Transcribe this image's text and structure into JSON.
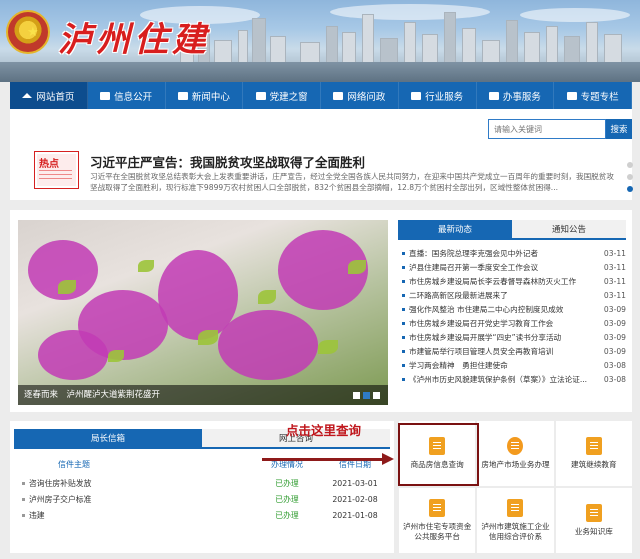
{
  "header": {
    "site_title": "泸州住建"
  },
  "nav": {
    "items": [
      {
        "label": "网站首页",
        "icon": "home-icon",
        "active": true
      },
      {
        "label": "信息公开",
        "icon": "info-icon"
      },
      {
        "label": "新闻中心",
        "icon": "news-icon"
      },
      {
        "label": "党建之窗",
        "icon": "party-icon"
      },
      {
        "label": "网络问政",
        "icon": "consult-icon"
      },
      {
        "label": "行业服务",
        "icon": "service-icon"
      },
      {
        "label": "办事服务",
        "icon": "affairs-icon"
      },
      {
        "label": "专题专栏",
        "icon": "topic-icon"
      }
    ]
  },
  "search": {
    "placeholder": "请输入关键词",
    "button": "搜索"
  },
  "feature": {
    "badge": "热点",
    "headline": "习近平庄严宣告：我国脱贫攻坚战取得了全面胜利",
    "summary": "习近平在全国脱贫攻坚总结表彰大会上发表重要讲话，庄严宣告，经过全党全国各族人民共同努力，在迎来中国共产党成立一百周年的重要时刻，我国脱贫攻坚战取得了全面胜利，现行标准下9899万农村贫困人口全部脱贫，832个贫困县全部摘帽，12.8万个贫困村全部出列，区域性整体贫困得..."
  },
  "photo": {
    "caption": "逐春而来　泸州醒泸大道紫荆花盛开"
  },
  "news_tabs": [
    "最新动态",
    "通知公告"
  ],
  "news": [
    {
      "title": "直播：国务院总理李克强会见中外记者",
      "date": "03-11"
    },
    {
      "title": "泸县住建局召开第一季度安全工作会议",
      "date": "03-11"
    },
    {
      "title": "市住房城乡建设局局长李云春督导森林防灭火工作",
      "date": "03-11"
    },
    {
      "title": "二环路高新区段最新进展来了",
      "date": "03-11"
    },
    {
      "title": "强化作风整治 市住建局二中心内控制度见成效",
      "date": "03-09"
    },
    {
      "title": "市住房城乡建设局召开党史学习教育工作会",
      "date": "03-09"
    },
    {
      "title": "市住房城乡建设局开展学“四史”读书分享活动",
      "date": "03-09"
    },
    {
      "title": "市建管局举行项目管理人员安全再教育培训",
      "date": "03-09"
    },
    {
      "title": "学习两会精神　勇担住建使命",
      "date": "03-08"
    },
    {
      "title": "《泸州市历史风貌建筑保护条例（草案）》立法论证...",
      "date": "03-08"
    }
  ],
  "mailbox": {
    "tabs": [
      "局长信箱",
      "网上咨询"
    ],
    "columns": [
      "信件主题",
      "办理情况",
      "信件日期"
    ],
    "rows": [
      {
        "subject": "咨询住房补贴发放",
        "status": "已办理",
        "date": "2021-03-01"
      },
      {
        "subject": "泸州房子交户标准",
        "status": "已办理",
        "date": "2021-02-08"
      },
      {
        "subject": "违建",
        "status": "已办理",
        "date": "2021-01-08"
      }
    ]
  },
  "annotation": {
    "text": "点击这里查询"
  },
  "services": [
    {
      "label": "商品房信息查询",
      "icon": "document-icon"
    },
    {
      "label": "房地产市场业务办理",
      "icon": "send-icon"
    },
    {
      "label": "建筑继续教育",
      "icon": "education-icon"
    },
    {
      "label": "泸州市住宅专项资金公共服务平台",
      "icon": "fund-icon"
    },
    {
      "label": "泸州市建筑施工企业信用综合评价系",
      "icon": "credit-icon"
    },
    {
      "label": "业务知识库",
      "icon": "knowledge-icon"
    }
  ],
  "colors": {
    "nav_blue": "#1667b3",
    "title_red": "#d81e1e",
    "status_green": "#2e9b2e",
    "annotation_red": "#c0161c"
  }
}
